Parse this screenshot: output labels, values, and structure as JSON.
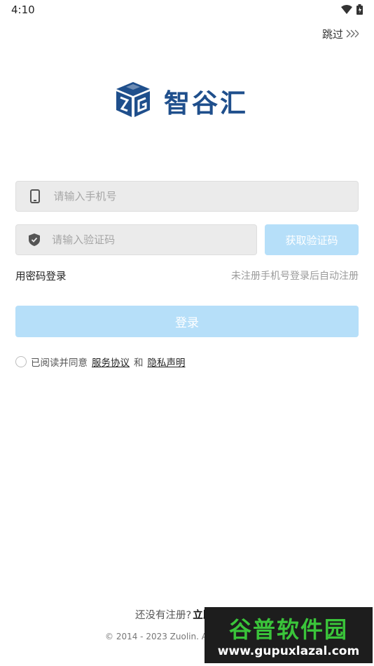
{
  "status_bar": {
    "time": "4:10"
  },
  "header": {
    "skip_label": "跳过"
  },
  "logo": {
    "app_name": "智谷汇"
  },
  "form": {
    "phone_placeholder": "请输入手机号",
    "code_placeholder": "请输入验证码",
    "get_code_label": "获取验证码",
    "password_login_label": "用密码登录",
    "auto_register_hint": "未注册手机号登录后自动注册",
    "login_label": "登录"
  },
  "agreement": {
    "prefix": "已阅读并同意",
    "service_link": "服务协议",
    "and": "和",
    "privacy_link": "隐私声明"
  },
  "footer": {
    "no_account_text": "还没有注册?",
    "register_link": "立即注册",
    "copyright": "© 2014 - 2023 Zuolin. All"
  },
  "watermark": {
    "title": "谷普软件园",
    "url": "www.gupuxlazal.com"
  },
  "colors": {
    "brand_blue": "#1f4f8c",
    "disabled_button": "#b6dff9",
    "field_bg": "#ebebeb"
  }
}
